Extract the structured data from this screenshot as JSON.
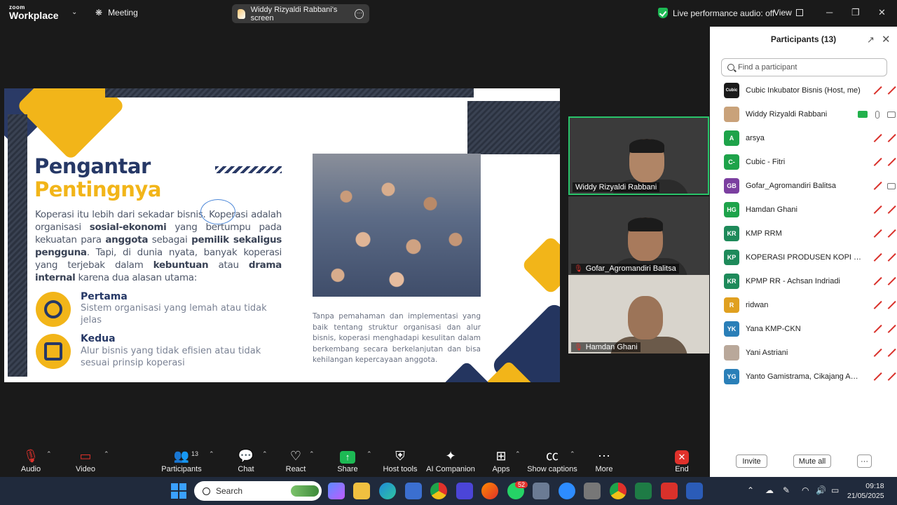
{
  "topbar": {
    "logo_small": "zoom",
    "logo_big": "Workplace",
    "meeting_label": "Meeting",
    "share_pill": "Widdy Rizyaldi Rabbani's screen",
    "perf_text": "Live performance audio: off",
    "view_label": "View"
  },
  "slide": {
    "title1": "Pengantar",
    "title2": "Pentingnya",
    "body_parts": [
      "Koperasi itu lebih dari sekadar bisnis. Koperasi adalah organisasi ",
      "sosial-ekonomi",
      " yang bertumpu pada kekuatan para ",
      "anggota",
      " sebagai ",
      "pemilik sekaligus pengguna",
      ". Tapi, di dunia nyata, banyak koperasi yang terjebak dalam ",
      "kebuntuan",
      " atau ",
      "drama internal",
      " karena dua alasan utama:"
    ],
    "points": [
      {
        "head": "Pertama",
        "desc": "Sistem organisasi yang lemah atau tidak jelas"
      },
      {
        "head": "Kedua",
        "desc": "Alur bisnis yang tidak efisien atau tidak sesuai prinsip koperasi"
      }
    ],
    "caption": "Tanpa pemahaman dan implementasi yang baik tentang struktur organisasi dan alur bisnis, koperasi menghadapi kesulitan dalam berkembang secara berkelanjutan dan bisa kehilangan kepercayaan anggota."
  },
  "tiles": [
    {
      "name": "Widdy Rizyaldi Rabbani",
      "muted": false
    },
    {
      "name": "Gofar_Agromandiri Balitsa",
      "muted": true
    },
    {
      "name": "Hamdan Ghani",
      "muted": true
    }
  ],
  "panel": {
    "title": "Participants (13)",
    "search_placeholder": "Find a participant",
    "participants": [
      {
        "initials": "Cubic",
        "name": "Cubic Inkubator Bisnis (Host, me)",
        "color": "#1a1a1a"
      },
      {
        "initials": "",
        "name": "Widdy Rizyaldi Rabbani",
        "color": "#c9a27a"
      },
      {
        "initials": "A",
        "name": "arsya",
        "color": "#1ea34a"
      },
      {
        "initials": "C-",
        "name": "Cubic - Fitri",
        "color": "#1ea34a"
      },
      {
        "initials": "GB",
        "name": "Gofar_Agromandiri Balitsa",
        "color": "#7b3fa0"
      },
      {
        "initials": "HG",
        "name": "Hamdan Ghani",
        "color": "#1ea34a"
      },
      {
        "initials": "KR",
        "name": "KMP RRM",
        "color": "#1e8a5a"
      },
      {
        "initials": "KP",
        "name": "KOPERASI PRODUSEN KOPI MAN...",
        "color": "#1e8a5a"
      },
      {
        "initials": "KR",
        "name": "KPMP RR - Achsan Indriadi",
        "color": "#1e8a5a"
      },
      {
        "initials": "R",
        "name": "ridwan",
        "color": "#e0a020"
      },
      {
        "initials": "YK",
        "name": "Yana KMP-CKN",
        "color": "#2a7fb8"
      },
      {
        "initials": "",
        "name": "Yani Astriani",
        "color": "#b9a89a"
      },
      {
        "initials": "YG",
        "name": "Yanto Gamistrama, Cikajang Agro ...",
        "color": "#2a7fb8"
      }
    ],
    "invite_label": "Invite",
    "mute_all_label": "Mute all",
    "more_label": "···"
  },
  "toolbar": {
    "audio": "Audio",
    "video": "Video",
    "participants": "Participants",
    "participants_count": "13",
    "chat": "Chat",
    "react": "React",
    "share": "Share",
    "host_tools": "Host tools",
    "ai_companion": "AI Companion",
    "apps": "Apps",
    "captions": "Show captions",
    "more": "More",
    "end": "End"
  },
  "taskbar": {
    "search": "Search",
    "badge": "52",
    "time": "09:18",
    "date": "21/05/2025"
  },
  "colors": {
    "navy": "#263866",
    "yellow": "#f2b519",
    "active_border": "#29c46a",
    "mute_red": "#e0312b"
  }
}
